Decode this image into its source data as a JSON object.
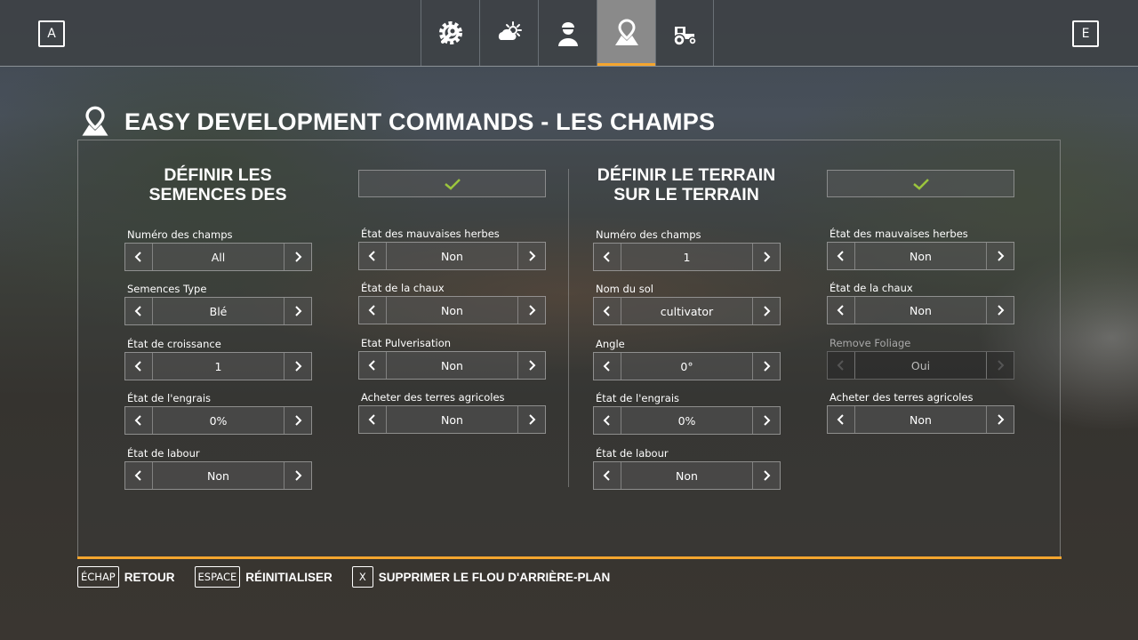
{
  "topbar": {
    "left_key": "A",
    "right_key": "E",
    "tabs": [
      {
        "icon": "gear-wrench-icon",
        "active": false
      },
      {
        "icon": "weather-icon",
        "active": false
      },
      {
        "icon": "farmer-icon",
        "active": false
      },
      {
        "icon": "map-pin-icon",
        "active": true
      },
      {
        "icon": "tractor-icon",
        "active": false
      }
    ]
  },
  "page": {
    "title": "EASY DEVELOPMENT COMMANDS - LES CHAMPS",
    "title_icon": "map-pin-icon"
  },
  "colors": {
    "accent": "#f4a52e",
    "check": "#9bc53d"
  },
  "sections": [
    {
      "title_line1": "DÉFINIR LES",
      "title_line2": "SEMENCES DES",
      "apply_icon": "checkmark-icon",
      "left_fields": [
        {
          "label": "Numéro des champs",
          "value": "All"
        },
        {
          "label": "Semences Type",
          "value": "Blé"
        },
        {
          "label": "État de croissance",
          "value": "1"
        },
        {
          "label": "État de l'engrais",
          "value": "0%"
        },
        {
          "label": "État de labour",
          "value": "Non"
        }
      ],
      "right_fields": [
        {
          "label": "État des mauvaises herbes",
          "value": "Non"
        },
        {
          "label": "État de la chaux",
          "value": "Non"
        },
        {
          "label": "Etat Pulverisation",
          "value": "Non"
        },
        {
          "label": "Acheter des terres agricoles",
          "value": "Non"
        }
      ]
    },
    {
      "title_line1": "DÉFINIR LE TERRAIN",
      "title_line2": "SUR LE TERRAIN",
      "apply_icon": "checkmark-icon",
      "left_fields": [
        {
          "label": "Numéro des champs",
          "value": "1"
        },
        {
          "label": "Nom du sol",
          "value": "cultivator"
        },
        {
          "label": "Angle",
          "value": "0°"
        },
        {
          "label": "État de l'engrais",
          "value": "0%"
        },
        {
          "label": "État de labour",
          "value": "Non"
        }
      ],
      "right_fields": [
        {
          "label": "État des mauvaises herbes",
          "value": "Non"
        },
        {
          "label": "État de la chaux",
          "value": "Non"
        },
        {
          "label": "Remove Foliage",
          "value": "Oui",
          "disabled": true
        },
        {
          "label": "Acheter des terres agricoles",
          "value": "Non"
        }
      ]
    }
  ],
  "footer": [
    {
      "key": "ÉCHAP",
      "label": "RETOUR"
    },
    {
      "key": "ESPACE",
      "label": "RÉINITIALISER"
    },
    {
      "key": "X",
      "label": "SUPPRIMER LE FLOU D'ARRIÈRE-PLAN"
    }
  ]
}
